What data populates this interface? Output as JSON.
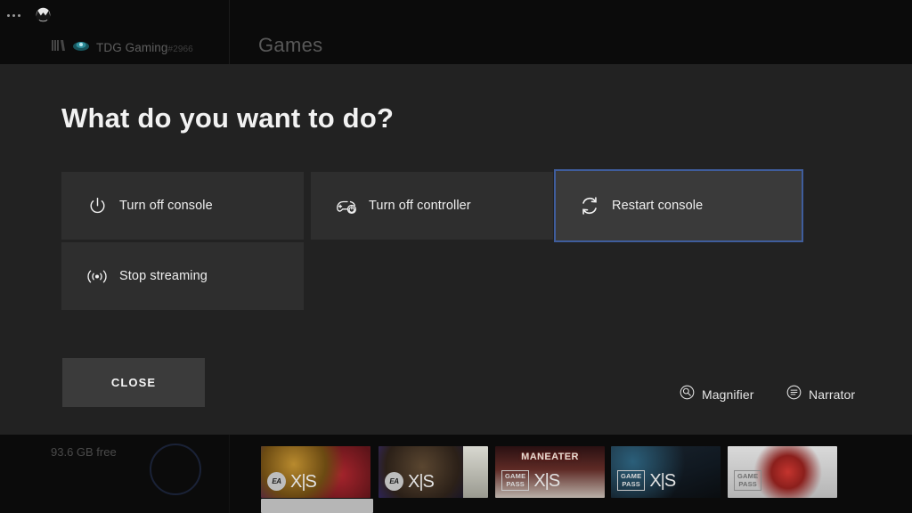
{
  "background": {
    "top_bar": {
      "menu_icon": "ellipsis-icon",
      "xbox_icon": "xbox-logo-icon",
      "library_icon": "library-icon",
      "cloud_icon": "cloud-icon",
      "gamertag": "TDG Gaming",
      "gamertag_number": "#2966",
      "section_title": "Games"
    },
    "storage_text": "93.6 GB free",
    "tiles": [
      {
        "name": "tile-ea-1",
        "badges": [
          "EA",
          "X|S"
        ],
        "title": ""
      },
      {
        "name": "tile-ea-2",
        "badges": [
          "EA",
          "X|S"
        ],
        "title": ""
      },
      {
        "name": "tile-maneater",
        "badges": [
          "GAME PASS",
          "X|S"
        ],
        "title": "MANEATER"
      },
      {
        "name": "tile-gamepass-1",
        "badges": [
          "GAME PASS",
          "X|S"
        ],
        "title": ""
      },
      {
        "name": "tile-gamepass-2",
        "badges": [
          "GAME PASS"
        ],
        "title": ""
      }
    ],
    "badge_labels": {
      "ea": "EA",
      "xs": "X|S",
      "gamepass_line1": "GAME",
      "gamepass_line2": "PASS"
    }
  },
  "overlay": {
    "title": "What do you want to do?",
    "options": [
      {
        "id": "turn-off-console",
        "label": "Turn off console",
        "icon": "power-icon",
        "selected": false
      },
      {
        "id": "turn-off-controller",
        "label": "Turn off controller",
        "icon": "gamepad-power-icon",
        "selected": false
      },
      {
        "id": "restart-console",
        "label": "Restart console",
        "icon": "restart-icon",
        "selected": true
      },
      {
        "id": "stop-streaming",
        "label": "Stop streaming",
        "icon": "broadcast-icon",
        "selected": false
      }
    ],
    "close_label": "CLOSE",
    "accessibility": [
      {
        "id": "magnifier",
        "label": "Magnifier",
        "icon": "magnifier-icon"
      },
      {
        "id": "narrator",
        "label": "Narrator",
        "icon": "narrator-icon"
      }
    ]
  },
  "colors": {
    "selection_border": "#3f5d9c",
    "button_fill": "#2e2e2e",
    "button_fill_selected": "#3a3a3a",
    "overlay_bg": "#222222",
    "page_bg": "#0b0b0b",
    "text_primary": "#efefef"
  }
}
